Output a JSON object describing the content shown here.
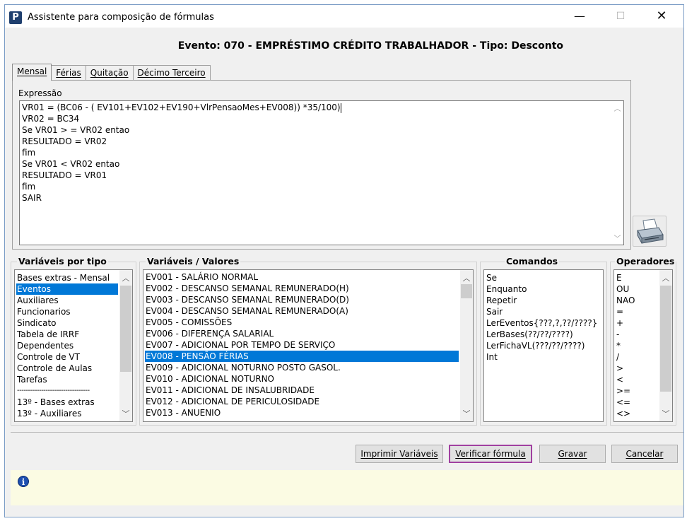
{
  "window": {
    "title": "Assistente para composição de fórmulas",
    "min_glyph": "—",
    "max_glyph": "☐",
    "close_glyph": "✕"
  },
  "event_header": "Evento: 070 - EMPRÉSTIMO CRÉDITO TRABALHADOR - Tipo: Desconto",
  "tabs": [
    {
      "label": "Mensal",
      "active": true
    },
    {
      "label": "Férias",
      "active": false
    },
    {
      "label": "Quitação",
      "active": false
    },
    {
      "label": "Décimo Terceiro",
      "active": false
    }
  ],
  "expression": {
    "label": "Expressão",
    "lines": [
      "VR01 = (BC06 - ( EV101+EV102+EV190+VlrPensaoMes+EV008)) *35/100)",
      "VR02 = BC34",
      "Se VR01 > = VR02 entao",
      "RESULTADO = VR02",
      "fim",
      "Se VR01 < VR02 entao",
      "RESULTADO = VR01",
      "fim",
      "SAIR"
    ]
  },
  "variaveis_por_tipo": {
    "title": "Variáveis por tipo",
    "items": [
      "Bases extras - Mensal",
      "Eventos",
      "Auxiliares",
      "Funcionarios",
      "Sindicato",
      "Tabela de IRRF",
      "Dependentes",
      "Controle de VT",
      "Controle de Aulas",
      "Tarefas",
      "---------------------------------",
      "13º - Bases extras",
      "13º - Auxiliares"
    ],
    "selected": "Eventos"
  },
  "variaveis_valores": {
    "title": "Variáveis / Valores",
    "items": [
      "EV001 - SALÁRIO NORMAL",
      "EV002 - DESCANSO SEMANAL REMUNERADO(H)",
      "EV003 - DESCANSO SEMANAL REMUNERADO(D)",
      "EV004 - DESCANSO SEMANAL REMUNERADO(A)",
      "EV005 - COMISSÕES",
      "EV006 - DIFERENÇA SALARIAL",
      "EV007 - ADICIONAL POR TEMPO DE SERVIÇO",
      "EV008 - PENSÃO FÉRIAS",
      "EV009 - ADICIONAL NOTURNO POSTO GASOL.",
      "EV010 - ADICIONAL NOTURNO",
      "EV011 - ADICIONAL DE INSALUBRIDADE",
      "EV012 - ADICIONAL DE PERICULOSIDADE",
      "EV013 - ANUENIO"
    ],
    "selected": "EV008 - PENSÃO FÉRIAS"
  },
  "comandos": {
    "title": "Comandos",
    "items": [
      "Se",
      "Enquanto",
      "Repetir",
      "Sair",
      "LerEventos{???,?,??/????}",
      "LerBases(??/??/????)",
      "LerFichaVL(???/??/????)",
      "Int"
    ]
  },
  "operadores": {
    "title": "Operadores",
    "items": [
      "E",
      "OU",
      "NAO",
      "=",
      "+",
      "-",
      "*",
      "/",
      ">",
      "<",
      ">=",
      "<=",
      "<>"
    ]
  },
  "buttons": {
    "imprimir": "Imprimir Variáveis",
    "verificar": "Verificar fórmula",
    "gravar": "Gravar",
    "cancelar": "Cancelar"
  },
  "info_glyph": "i",
  "app_icon_glyph": "P",
  "accent_color": "#0078d7",
  "focus_color": "#a040a0"
}
